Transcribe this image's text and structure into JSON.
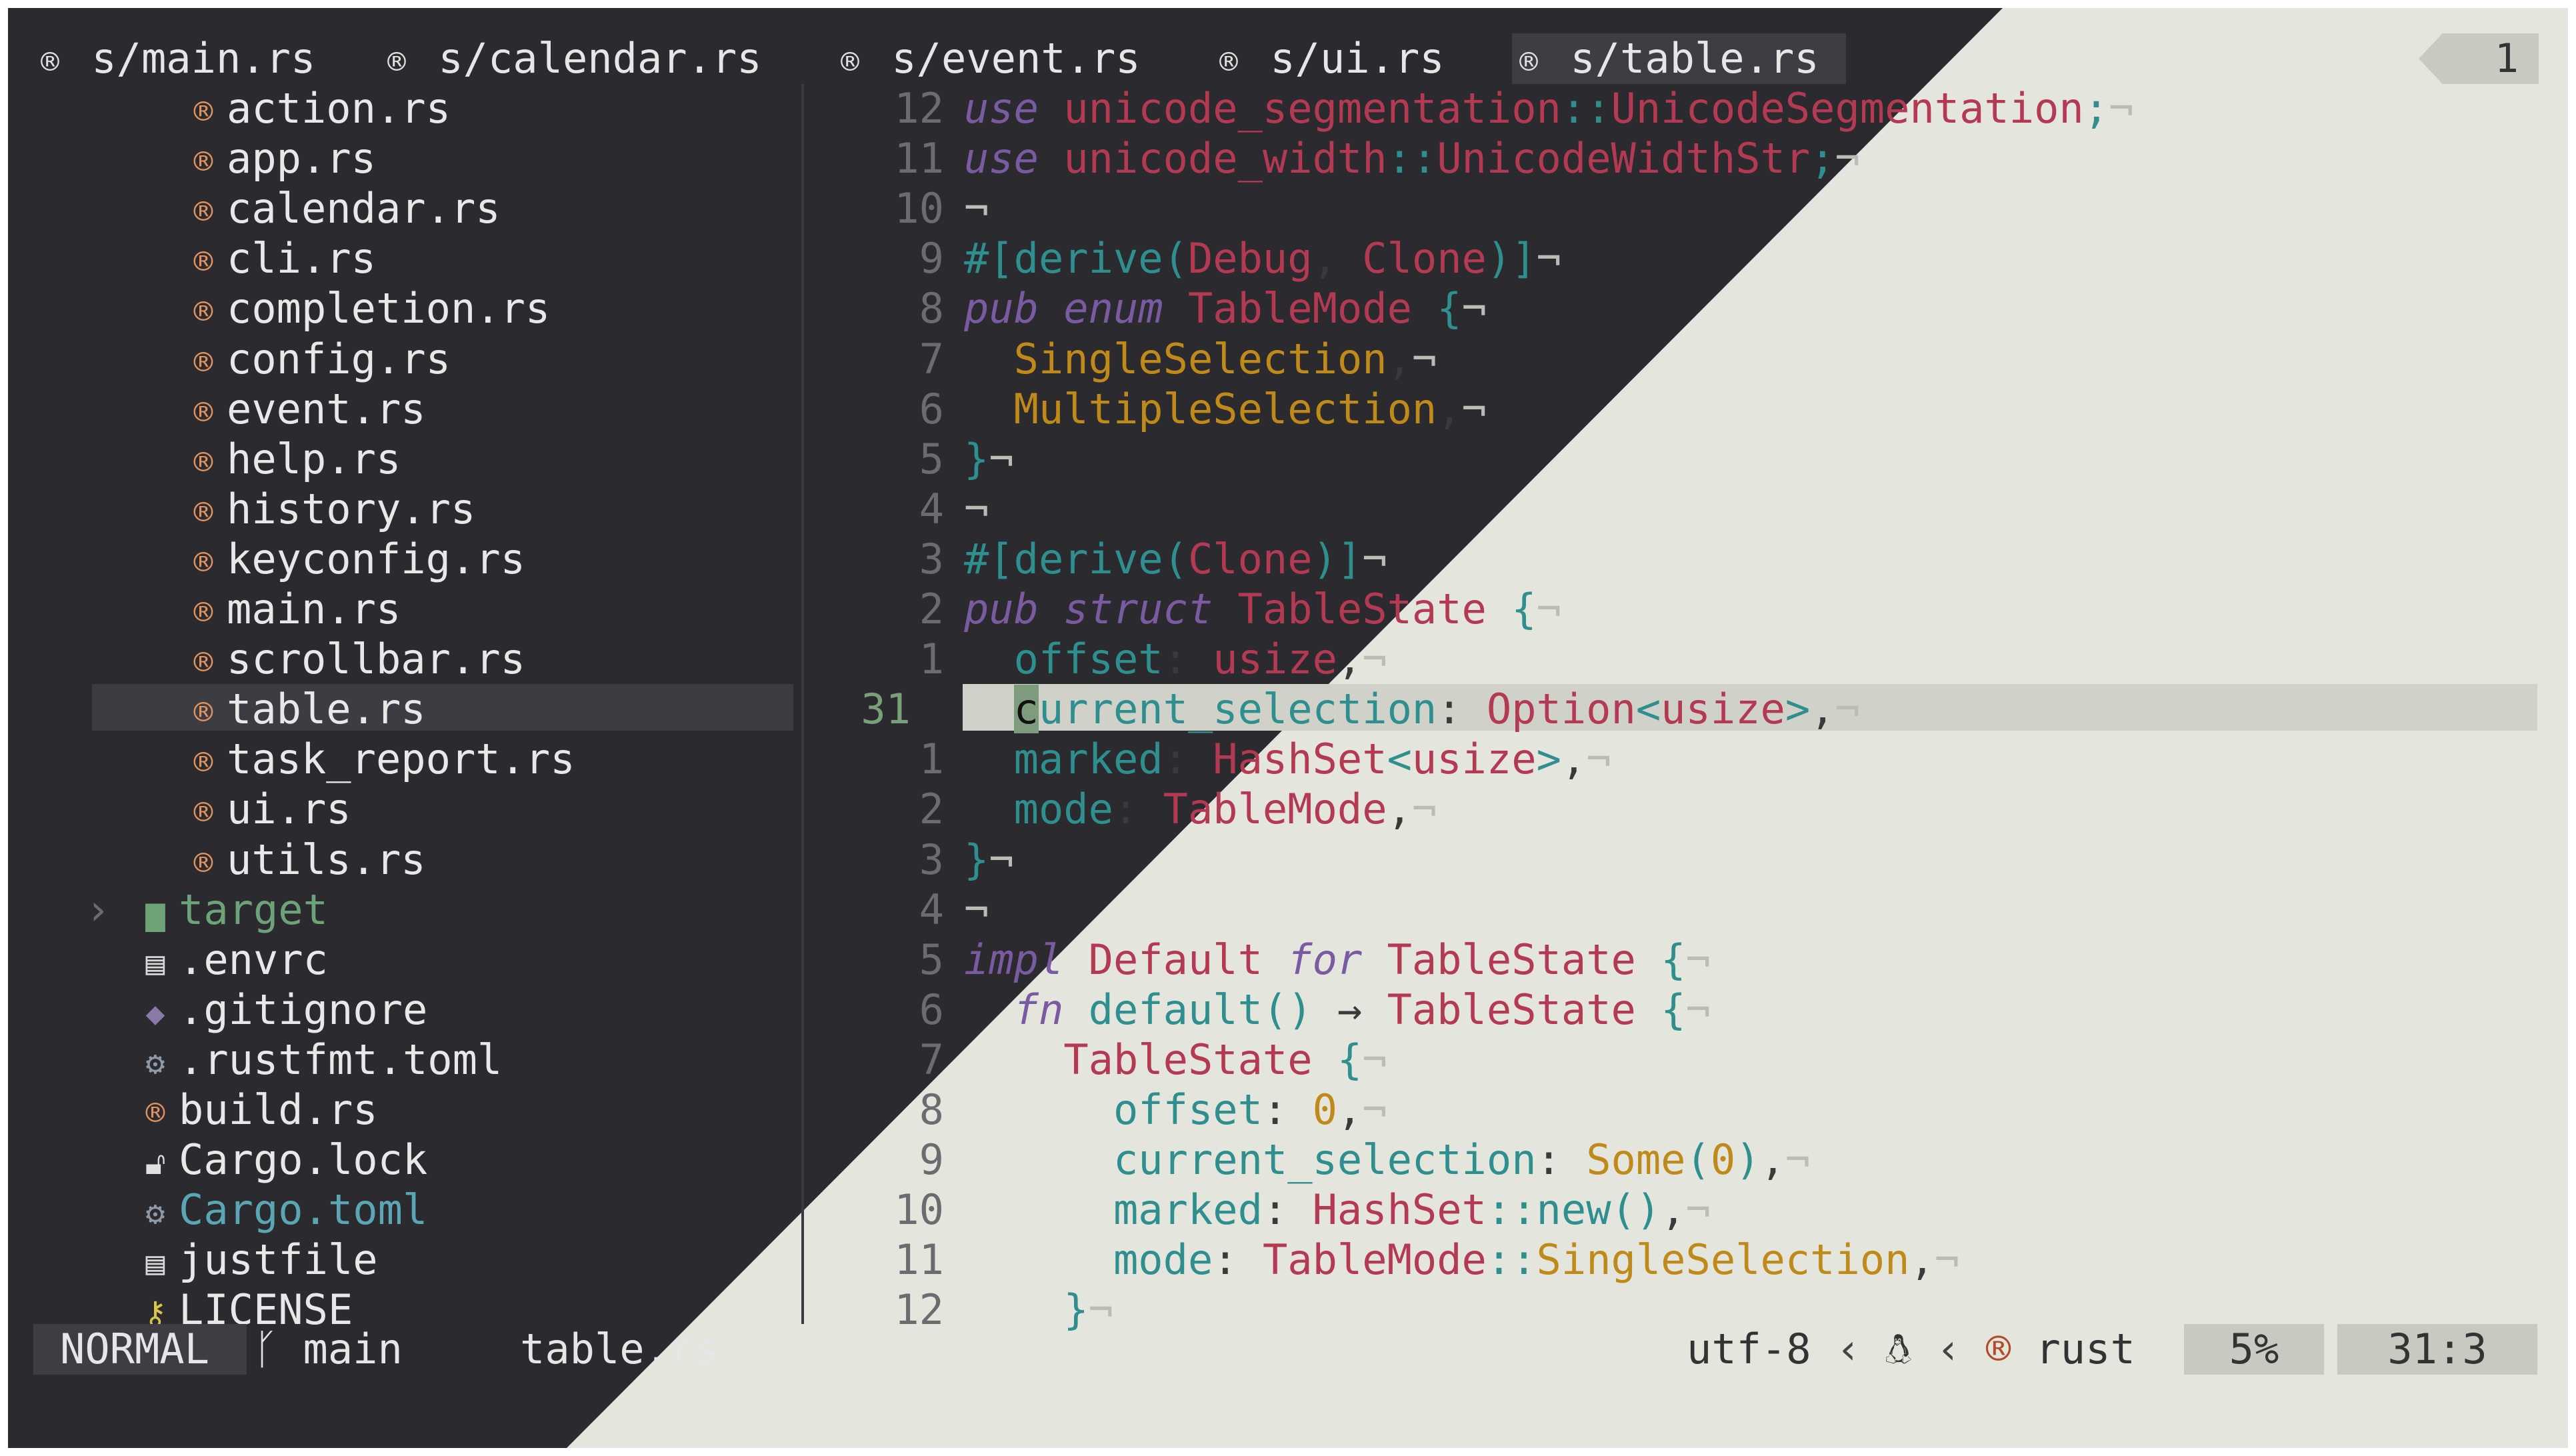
{
  "colors": {
    "dark_bg": "#2a2a2f",
    "light_bg": "#e4e5dd",
    "accent_teal": "#2f8f8f",
    "accent_red": "#b33a52"
  },
  "tabs": [
    {
      "label": "s/main.rs",
      "icon": "rust-icon"
    },
    {
      "label": "s/calendar.rs",
      "icon": "rust-icon"
    },
    {
      "label": "s/event.rs",
      "icon": "rust-icon"
    },
    {
      "label": "s/ui.rs",
      "icon": "rust-icon"
    },
    {
      "label": "s/table.rs",
      "icon": "rust-icon"
    }
  ],
  "tab_count": "1",
  "tree": {
    "items": [
      {
        "label": "action.rs",
        "icon": "rust-icon"
      },
      {
        "label": "app.rs",
        "icon": "rust-icon"
      },
      {
        "label": "calendar.rs",
        "icon": "rust-icon"
      },
      {
        "label": "cli.rs",
        "icon": "rust-icon"
      },
      {
        "label": "completion.rs",
        "icon": "rust-icon"
      },
      {
        "label": "config.rs",
        "icon": "rust-icon"
      },
      {
        "label": "event.rs",
        "icon": "rust-icon"
      },
      {
        "label": "help.rs",
        "icon": "rust-icon"
      },
      {
        "label": "history.rs",
        "icon": "rust-icon"
      },
      {
        "label": "keyconfig.rs",
        "icon": "rust-icon"
      },
      {
        "label": "main.rs",
        "icon": "rust-icon"
      },
      {
        "label": "scrollbar.rs",
        "icon": "rust-icon"
      },
      {
        "label": "table.rs",
        "icon": "rust-icon"
      },
      {
        "label": "task_report.rs",
        "icon": "rust-icon"
      },
      {
        "label": "ui.rs",
        "icon": "rust-icon"
      },
      {
        "label": "utils.rs",
        "icon": "rust-icon"
      },
      {
        "label": "target",
        "icon": "folder-icon"
      },
      {
        "label": ".envrc",
        "icon": "file-icon"
      },
      {
        "label": ".gitignore",
        "icon": "git-icon"
      },
      {
        "label": ".rustfmt.toml",
        "icon": "gear-icon"
      },
      {
        "label": "build.rs",
        "icon": "rust-icon"
      },
      {
        "label": "Cargo.lock",
        "icon": "lock-icon"
      },
      {
        "label": "Cargo.toml",
        "icon": "gear-icon"
      },
      {
        "label": "justfile",
        "icon": "file-icon"
      },
      {
        "label": "LICENSE",
        "icon": "key-icon"
      }
    ]
  },
  "code": {
    "line_numbers": [
      "12",
      "11",
      "10",
      "9",
      "8",
      "7",
      "6",
      "5",
      "4",
      "3",
      "2",
      "1",
      "31",
      "1",
      "2",
      "3",
      "4",
      "5",
      "6",
      "7",
      "8",
      "9",
      "10",
      "11",
      "12"
    ],
    "lines": [
      "use unicode_segmentation::UnicodeSegmentation;",
      "use unicode_width::UnicodeWidthStr;",
      "",
      "#[derive(Debug, Clone)]",
      "pub enum TableMode {",
      "  SingleSelection,",
      "  MultipleSelection,",
      "}",
      "",
      "#[derive(Clone)]",
      "pub struct TableState {",
      "  offset: usize,",
      "  current_selection: Option<usize>,",
      "  marked: HashSet<usize>,",
      "  mode: TableMode,",
      "}",
      "",
      "impl Default for TableState {",
      "  fn default() -> TableState {",
      "    TableState {",
      "      offset: 0,",
      "      current_selection: Some(0),",
      "      marked: HashSet::new(),",
      "      mode: TableMode::SingleSelection,",
      "    }"
    ]
  },
  "status": {
    "mode": "NORMAL",
    "branch": "main",
    "file": "table.rs",
    "encoding": "utf-8",
    "filetype": "rust",
    "percent": "5%",
    "position": "31:3"
  }
}
